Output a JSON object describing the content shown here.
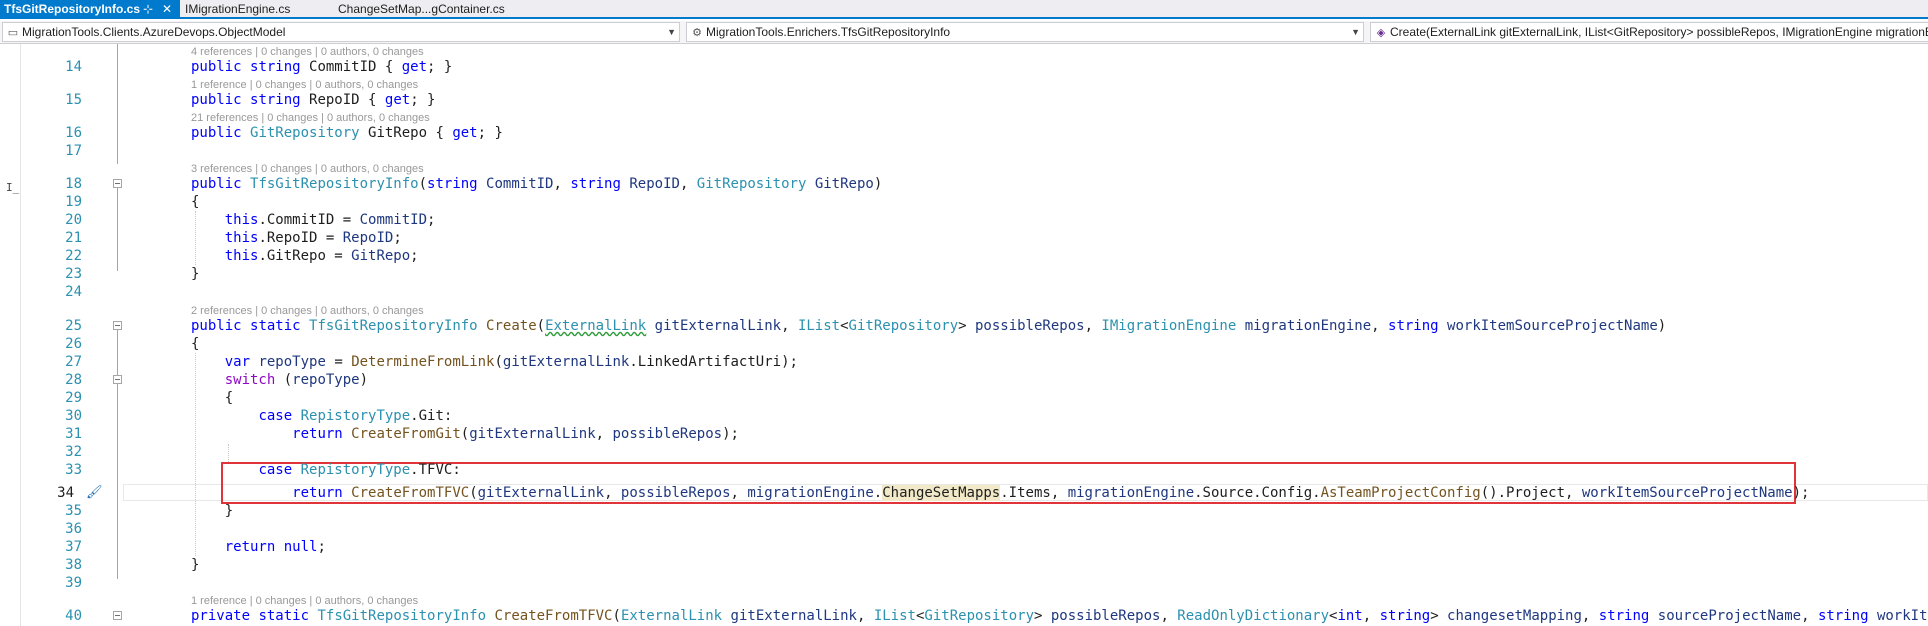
{
  "tabs": [
    {
      "label": "TfsGitRepositoryInfo.cs",
      "pin": "⊹",
      "close": "✕"
    },
    {
      "label": "IMigrationEngine.cs"
    },
    {
      "label": "ChangeSetMap...gContainer.cs"
    }
  ],
  "nav": {
    "project": "MigrationTools.Clients.AzureDevops.ObjectModel",
    "type": "MigrationTools.Enrichers.TfsGitRepositoryInfo",
    "member": "Create(ExternalLink gitExternalLink, IList<GitRepository> possibleRepos, IMigrationEngine migrationEngine, string workItemSourceProjectName)"
  },
  "editor": {
    "line_numbers": [
      "14",
      "15",
      "16",
      "17",
      "18",
      "19",
      "20",
      "21",
      "22",
      "23",
      "24",
      "25",
      "26",
      "27",
      "28",
      "29",
      "30",
      "31",
      "32",
      "33",
      "34",
      "35",
      "36",
      "37",
      "38",
      "39",
      "40"
    ],
    "codelens": [
      "4 references | 0 changes | 0 authors, 0 changes",
      "1 reference | 0 changes | 0 authors, 0 changes",
      "21 references | 0 changes | 0 authors, 0 changes",
      "3 references | 0 changes | 0 authors, 0 changes",
      "2 references | 0 changes | 0 authors, 0 changes",
      "1 reference | 0 changes | 0 authors, 0 changes"
    ],
    "current_line": "34",
    "highlighted_symbol": "ChangeSetMapps",
    "icons": {
      "caret": "I̲",
      "quick_action": "lightbulb-brush-icon"
    }
  }
}
